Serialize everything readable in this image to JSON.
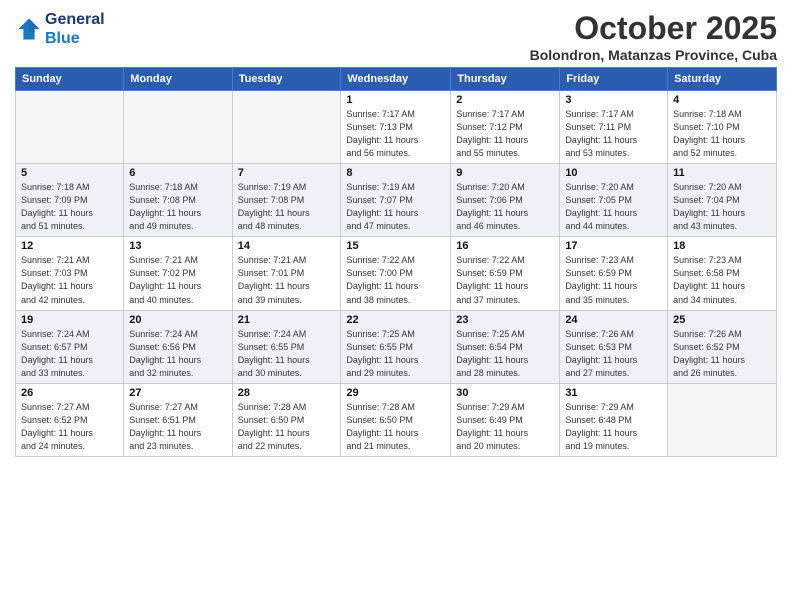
{
  "logo": {
    "line1": "General",
    "line2": "Blue"
  },
  "title": "October 2025",
  "location": "Bolondron, Matanzas Province, Cuba",
  "days_of_week": [
    "Sunday",
    "Monday",
    "Tuesday",
    "Wednesday",
    "Thursday",
    "Friday",
    "Saturday"
  ],
  "weeks": [
    [
      {
        "num": "",
        "info": ""
      },
      {
        "num": "",
        "info": ""
      },
      {
        "num": "",
        "info": ""
      },
      {
        "num": "1",
        "info": "Sunrise: 7:17 AM\nSunset: 7:13 PM\nDaylight: 11 hours\nand 56 minutes."
      },
      {
        "num": "2",
        "info": "Sunrise: 7:17 AM\nSunset: 7:12 PM\nDaylight: 11 hours\nand 55 minutes."
      },
      {
        "num": "3",
        "info": "Sunrise: 7:17 AM\nSunset: 7:11 PM\nDaylight: 11 hours\nand 53 minutes."
      },
      {
        "num": "4",
        "info": "Sunrise: 7:18 AM\nSunset: 7:10 PM\nDaylight: 11 hours\nand 52 minutes."
      }
    ],
    [
      {
        "num": "5",
        "info": "Sunrise: 7:18 AM\nSunset: 7:09 PM\nDaylight: 11 hours\nand 51 minutes."
      },
      {
        "num": "6",
        "info": "Sunrise: 7:18 AM\nSunset: 7:08 PM\nDaylight: 11 hours\nand 49 minutes."
      },
      {
        "num": "7",
        "info": "Sunrise: 7:19 AM\nSunset: 7:08 PM\nDaylight: 11 hours\nand 48 minutes."
      },
      {
        "num": "8",
        "info": "Sunrise: 7:19 AM\nSunset: 7:07 PM\nDaylight: 11 hours\nand 47 minutes."
      },
      {
        "num": "9",
        "info": "Sunrise: 7:20 AM\nSunset: 7:06 PM\nDaylight: 11 hours\nand 46 minutes."
      },
      {
        "num": "10",
        "info": "Sunrise: 7:20 AM\nSunset: 7:05 PM\nDaylight: 11 hours\nand 44 minutes."
      },
      {
        "num": "11",
        "info": "Sunrise: 7:20 AM\nSunset: 7:04 PM\nDaylight: 11 hours\nand 43 minutes."
      }
    ],
    [
      {
        "num": "12",
        "info": "Sunrise: 7:21 AM\nSunset: 7:03 PM\nDaylight: 11 hours\nand 42 minutes."
      },
      {
        "num": "13",
        "info": "Sunrise: 7:21 AM\nSunset: 7:02 PM\nDaylight: 11 hours\nand 40 minutes."
      },
      {
        "num": "14",
        "info": "Sunrise: 7:21 AM\nSunset: 7:01 PM\nDaylight: 11 hours\nand 39 minutes."
      },
      {
        "num": "15",
        "info": "Sunrise: 7:22 AM\nSunset: 7:00 PM\nDaylight: 11 hours\nand 38 minutes."
      },
      {
        "num": "16",
        "info": "Sunrise: 7:22 AM\nSunset: 6:59 PM\nDaylight: 11 hours\nand 37 minutes."
      },
      {
        "num": "17",
        "info": "Sunrise: 7:23 AM\nSunset: 6:59 PM\nDaylight: 11 hours\nand 35 minutes."
      },
      {
        "num": "18",
        "info": "Sunrise: 7:23 AM\nSunset: 6:58 PM\nDaylight: 11 hours\nand 34 minutes."
      }
    ],
    [
      {
        "num": "19",
        "info": "Sunrise: 7:24 AM\nSunset: 6:57 PM\nDaylight: 11 hours\nand 33 minutes."
      },
      {
        "num": "20",
        "info": "Sunrise: 7:24 AM\nSunset: 6:56 PM\nDaylight: 11 hours\nand 32 minutes."
      },
      {
        "num": "21",
        "info": "Sunrise: 7:24 AM\nSunset: 6:55 PM\nDaylight: 11 hours\nand 30 minutes."
      },
      {
        "num": "22",
        "info": "Sunrise: 7:25 AM\nSunset: 6:55 PM\nDaylight: 11 hours\nand 29 minutes."
      },
      {
        "num": "23",
        "info": "Sunrise: 7:25 AM\nSunset: 6:54 PM\nDaylight: 11 hours\nand 28 minutes."
      },
      {
        "num": "24",
        "info": "Sunrise: 7:26 AM\nSunset: 6:53 PM\nDaylight: 11 hours\nand 27 minutes."
      },
      {
        "num": "25",
        "info": "Sunrise: 7:26 AM\nSunset: 6:52 PM\nDaylight: 11 hours\nand 26 minutes."
      }
    ],
    [
      {
        "num": "26",
        "info": "Sunrise: 7:27 AM\nSunset: 6:52 PM\nDaylight: 11 hours\nand 24 minutes."
      },
      {
        "num": "27",
        "info": "Sunrise: 7:27 AM\nSunset: 6:51 PM\nDaylight: 11 hours\nand 23 minutes."
      },
      {
        "num": "28",
        "info": "Sunrise: 7:28 AM\nSunset: 6:50 PM\nDaylight: 11 hours\nand 22 minutes."
      },
      {
        "num": "29",
        "info": "Sunrise: 7:28 AM\nSunset: 6:50 PM\nDaylight: 11 hours\nand 21 minutes."
      },
      {
        "num": "30",
        "info": "Sunrise: 7:29 AM\nSunset: 6:49 PM\nDaylight: 11 hours\nand 20 minutes."
      },
      {
        "num": "31",
        "info": "Sunrise: 7:29 AM\nSunset: 6:48 PM\nDaylight: 11 hours\nand 19 minutes."
      },
      {
        "num": "",
        "info": ""
      }
    ]
  ]
}
